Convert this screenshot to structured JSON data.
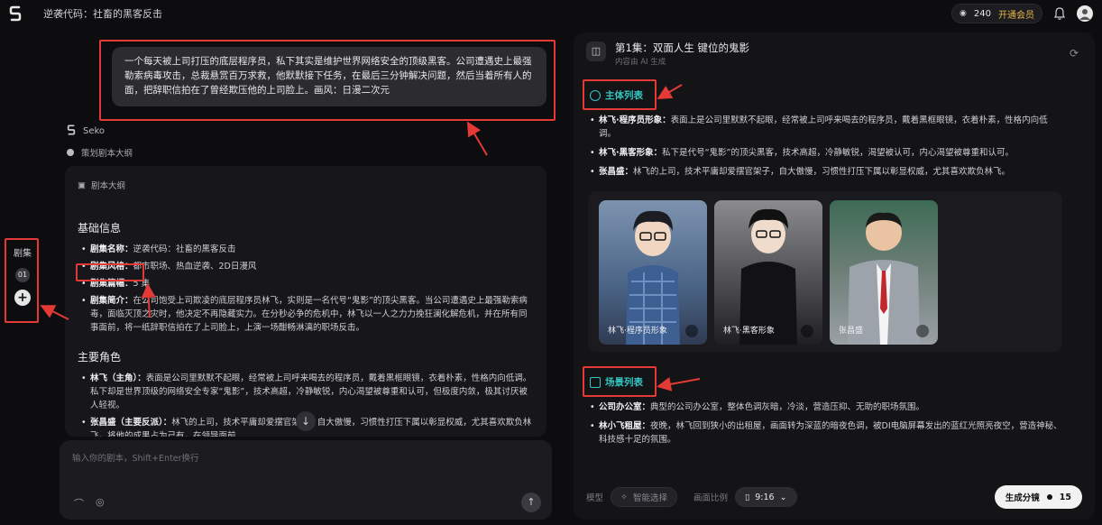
{
  "app": {
    "title": "逆袭代码：社畜的黑客反击"
  },
  "topbar": {
    "credits": "240",
    "vip_label": "开通会员"
  },
  "left_rail": {
    "label": "剧集",
    "episode_num": "01",
    "add_label": "+"
  },
  "user_prompt": "一个每天被上司打压的底层程序员，私下其实是维护世界网络安全的顶级黑客。公司遭遇史上最强勒索病毒攻击，总裁悬赏百万求救，他默默接下任务，在最后三分钟解决问题，然后当着所有人的面，把辞职信拍在了曾经欺压他的上司脸上。画风：日漫二次元",
  "assistant": {
    "name": "Seko",
    "status": "策划剧本大纲"
  },
  "outline": {
    "header": "剧本大纲",
    "basic_title": "基础信息",
    "basic_items": [
      {
        "label": "剧集名称：",
        "value": "逆袭代码：社畜的黑客反击"
      },
      {
        "label": "剧集风格：",
        "value": "都市职场、热血逆袭、2D日漫风"
      },
      {
        "label": "剧集篇幅：",
        "value": "5 集"
      },
      {
        "label": "剧集简介：",
        "value": "在公司饱受上司欺凌的底层程序员林飞，实则是一名代号“鬼影”的顶尖黑客。当公司遭遇史上最强勒索病毒，面临灭顶之灾时，他决定不再隐藏实力。在分秒必争的危机中，林飞以一人之力力挽狂澜化解危机，并在所有同事面前，将一纸辞职信拍在了上司脸上，上演一场酣畅淋漓的职场反击。"
      }
    ],
    "roles_title": "主要角色",
    "role_items": [
      {
        "label": "林飞（主角）：",
        "value": "表面是公司里默默不起眼，经常被上司呼来喝去的程序员，戴着黑框眼镜，衣着朴素，性格内向低调。私下却是世界顶级的网络安全专家“鬼影”，技术高超，冷静敏锐，内心渴望被尊重和认可，但极度内敛，极其讨厌被人轻视。"
      },
      {
        "label": "张昌盛（主要反派）：",
        "value": "林飞的上司，技术平庸却爱摆官架子，自大傲慢，习惯性打压下属以彰显权威，尤其喜欢欺负林飞，将他的成果占为己有，在领导面前……"
      }
    ],
    "scroll_icon": "arrow-down-icon"
  },
  "composer": {
    "placeholder": "输入你的剧本，Shift+Enter换行"
  },
  "right_panel": {
    "title": "第1集：双面人生 键位的鬼影",
    "subtitle": "内容由 AI 生成",
    "char_section": "主体列表",
    "char_items": [
      {
        "label": "林飞·程序员形象：",
        "value": "表面上是公司里默默不起眼，经常被上司呼来喝去的程序员，戴着黑框眼镜，衣着朴素，性格内向低调。"
      },
      {
        "label": "林飞·黑客形象：",
        "value": "私下是代号“鬼影”的顶尖黑客，技术高超，冷静敏锐，渴望被认可，内心渴望被尊重和认可。"
      },
      {
        "label": "张昌盛：",
        "value": "林飞的上司，技术平庸却爱摆官架子，自大傲慢，习惯性打压下属以彰显权威，尤其喜欢欺负林飞。"
      }
    ],
    "char_cards": [
      {
        "label": "林飞·程序员形象"
      },
      {
        "label": "林飞·黑客形象"
      },
      {
        "label": "张昌盛"
      }
    ],
    "scene_section": "场景列表",
    "scene_items": [
      {
        "label": "公司办公室：",
        "value": "典型的公司办公室，整体色调灰暗，冷淡，营造压抑、无助的职场氛围。"
      },
      {
        "label": "林小飞租屋：",
        "value": "夜晚，林飞回到狭小的出租屋，画面转为深蓝的暗夜色调，被DI电脑屏幕发出的蓝红光照亮夜空，营造神秘、科技感十足的氛围。"
      }
    ],
    "bottom": {
      "model_label": "模型",
      "model_placeholder": "智能选择",
      "ratio_label": "画面比例",
      "ratio_value": "9:16",
      "generate_label": "生成分镜",
      "generate_cost": "15"
    }
  }
}
